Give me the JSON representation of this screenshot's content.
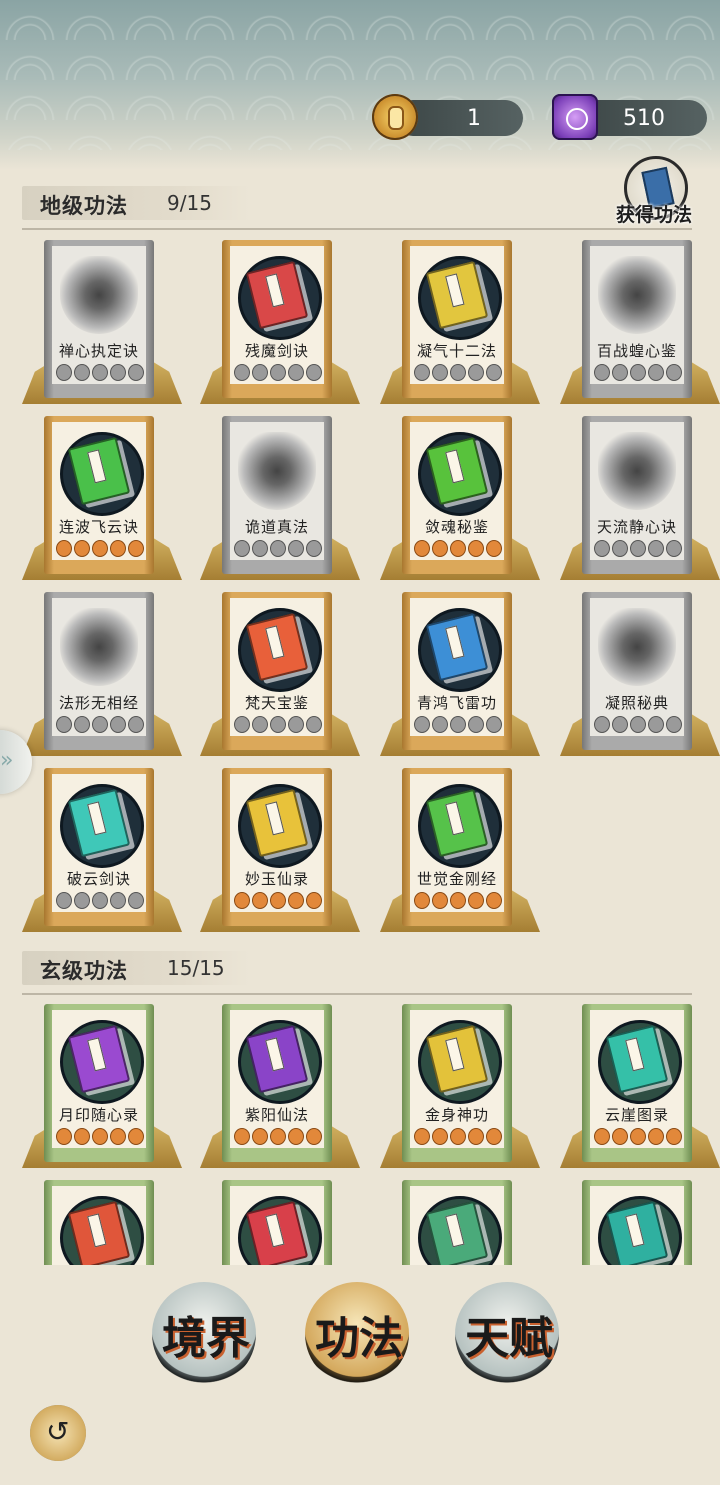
{
  "currencies": {
    "coin_value": "1",
    "gem_value": "510"
  },
  "obtain_button": {
    "label": "获得功法"
  },
  "sections": [
    {
      "title": "地级功法",
      "count": "9/15",
      "cards": [
        {
          "name": "禅心执定诀",
          "state": "locked",
          "stars": 0
        },
        {
          "name": "残魔剑诀",
          "state": "unlocked",
          "book_color": "#d94848",
          "stars": 0
        },
        {
          "name": "凝气十二法",
          "state": "unlocked",
          "book_color": "#e2c63e",
          "stars": 0
        },
        {
          "name": "百战蝗心鉴",
          "state": "locked",
          "stars": 0
        },
        {
          "name": "连波飞云诀",
          "state": "unlocked",
          "book_color": "#4ac04a",
          "stars": 5
        },
        {
          "name": "诡道真法",
          "state": "locked",
          "stars": 0
        },
        {
          "name": "敛魂秘鉴",
          "state": "unlocked",
          "book_color": "#58c23c",
          "stars": 5
        },
        {
          "name": "天流静心诀",
          "state": "locked",
          "stars": 0
        },
        {
          "name": "法形无相经",
          "state": "locked",
          "stars": 0
        },
        {
          "name": "梵天宝鉴",
          "state": "unlocked",
          "book_color": "#e8603a",
          "stars": 0
        },
        {
          "name": "青鸿飞雷功",
          "state": "unlocked",
          "book_color": "#3d8fd6",
          "stars": 0
        },
        {
          "name": "凝照秘典",
          "state": "locked",
          "stars": 0
        },
        {
          "name": "破云剑诀",
          "state": "unlocked",
          "book_color": "#3fc8b8",
          "stars": 0
        },
        {
          "name": "妙玉仙录",
          "state": "unlocked",
          "book_color": "#e8c23a",
          "stars": 5
        },
        {
          "name": "世觉金刚经",
          "state": "unlocked",
          "book_color": "#56c24a",
          "stars": 5
        }
      ]
    },
    {
      "title": "玄级功法",
      "count": "15/15",
      "cards": [
        {
          "name": "月印随心录",
          "state": "unlocked",
          "book_color": "#9a4ad0",
          "stars": 5
        },
        {
          "name": "紫阳仙法",
          "state": "unlocked",
          "book_color": "#8a44c8",
          "stars": 5
        },
        {
          "name": "金身神功",
          "state": "unlocked",
          "book_color": "#e3c23a",
          "stars": 5
        },
        {
          "name": "云崖图录",
          "state": "unlocked",
          "book_color": "#35c0a8",
          "stars": 5
        },
        {
          "name": "",
          "state": "unlocked",
          "book_color": "#e0563a",
          "stars": 0
        },
        {
          "name": "",
          "state": "unlocked",
          "book_color": "#d8404a",
          "stars": 0
        },
        {
          "name": "",
          "state": "unlocked",
          "book_color": "#4aaa7a",
          "stars": 0
        },
        {
          "name": "",
          "state": "unlocked",
          "book_color": "#2fb0a0",
          "stars": 0
        }
      ]
    }
  ],
  "nav": {
    "realm": "境界",
    "skills": "功法",
    "talent": "天赋"
  }
}
